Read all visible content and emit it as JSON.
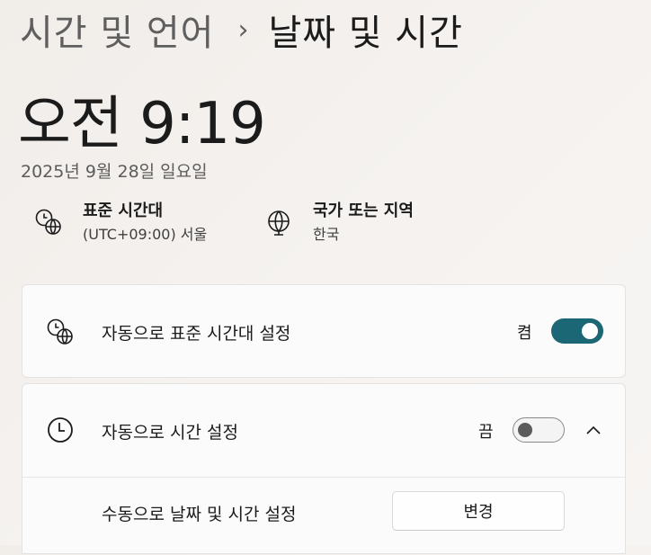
{
  "breadcrumb": {
    "parent": "시간 및 언어",
    "separator": "›",
    "current": "날짜 및 시간"
  },
  "clock": {
    "time": "오전 9:19",
    "date": "2025년 9월 28일 일요일"
  },
  "timezone_info": {
    "title": "표준 시간대",
    "value": "(UTC+09:00) 서울",
    "icon": "clock-globe-icon"
  },
  "region_info": {
    "title": "국가 또는 지역",
    "value": "한국",
    "icon": "globe-icon"
  },
  "settings": {
    "auto_timezone": {
      "label": "자동으로 표준 시간대 설정",
      "state_label": "켬",
      "enabled": true,
      "icon": "clock-globe-icon"
    },
    "auto_time": {
      "label": "자동으로 시간 설정",
      "state_label": "끔",
      "enabled": false,
      "icon": "clock-icon",
      "expanded": true
    },
    "manual_time": {
      "label": "수동으로 날짜 및 시간 설정",
      "button_label": "변경"
    }
  },
  "colors": {
    "accent": "#1b6775",
    "background": "#f3f0ed",
    "card": "#fbfbfb"
  }
}
